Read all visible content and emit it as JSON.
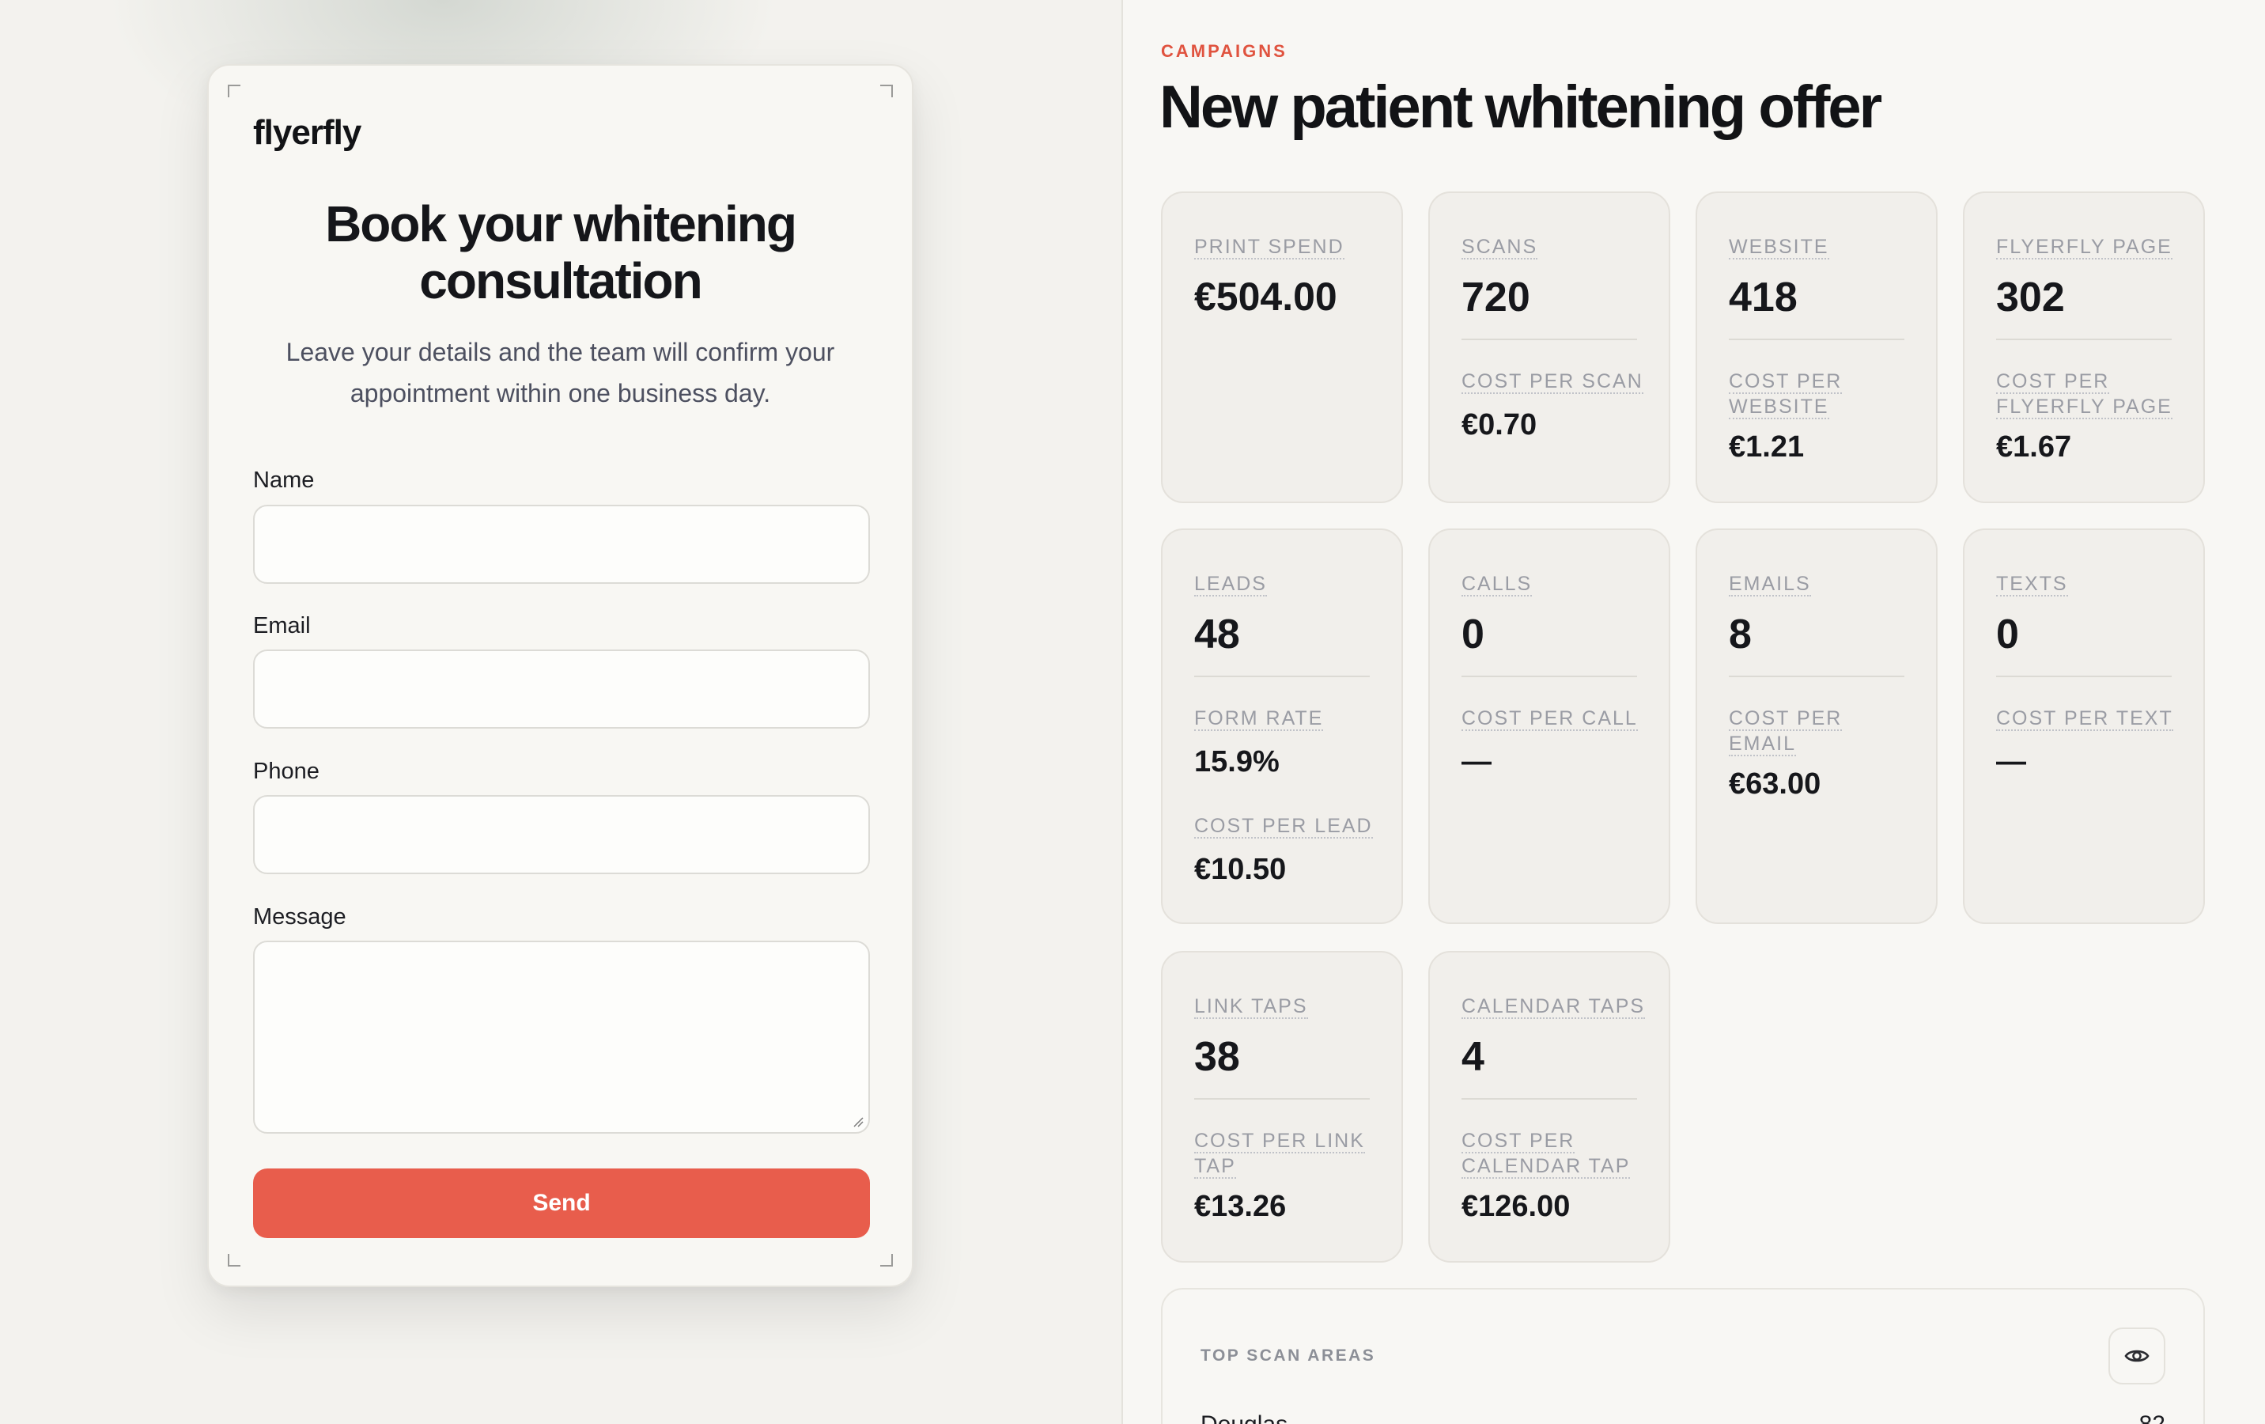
{
  "flyer": {
    "brand": "flyerfly",
    "title": "Book your whitening consultation",
    "subtitle": "Leave your details and the team will confirm your appointment within one business day.",
    "fields": {
      "name_label": "Name",
      "email_label": "Email",
      "phone_label": "Phone",
      "message_label": "Message"
    },
    "send_label": "Send"
  },
  "campaign": {
    "eyebrow": "CAMPAIGNS",
    "title": "New patient whitening offer"
  },
  "stats": {
    "print_spend": {
      "label": "Print spend",
      "value": "€504.00"
    },
    "scans": {
      "label": "Scans",
      "value": "720",
      "sub_label": "Cost per scan",
      "sub_value": "€0.70"
    },
    "website": {
      "label": "Website",
      "value": "418",
      "sub_label": "Cost per website",
      "sub_value": "€1.21"
    },
    "flyerfly_page": {
      "label": "Flyerfly page",
      "value": "302",
      "sub_label": "Cost per flyerfly page",
      "sub_value": "€1.67"
    },
    "leads": {
      "label": "Leads",
      "value": "48",
      "sub_label": "Form rate",
      "sub_value": "15.9%",
      "sub_label_2": "Cost per lead",
      "sub_value_2": "€10.50"
    },
    "calls": {
      "label": "Calls",
      "value": "0",
      "sub_label": "Cost per call",
      "sub_value": "—"
    },
    "emails": {
      "label": "Emails",
      "value": "8",
      "sub_label": "Cost per email",
      "sub_value": "€63.00"
    },
    "texts": {
      "label": "Texts",
      "value": "0",
      "sub_label": "Cost per text",
      "sub_value": "—"
    },
    "link_taps": {
      "label": "Link taps",
      "value": "38",
      "sub_label": "Cost per link tap",
      "sub_value": "€13.26"
    },
    "calendar_taps": {
      "label": "Calendar taps",
      "value": "4",
      "sub_label": "Cost per calendar tap",
      "sub_value": "€126.00"
    }
  },
  "top_scan_areas": {
    "title": "TOP SCAN AREAS",
    "icon": "eye-icon",
    "rows": [
      {
        "name": "Douglas",
        "value": "82"
      }
    ]
  },
  "colors": {
    "accent": "#e85d4c",
    "eyebrow": "#e0533f",
    "card_bg": "#f1efeb"
  }
}
